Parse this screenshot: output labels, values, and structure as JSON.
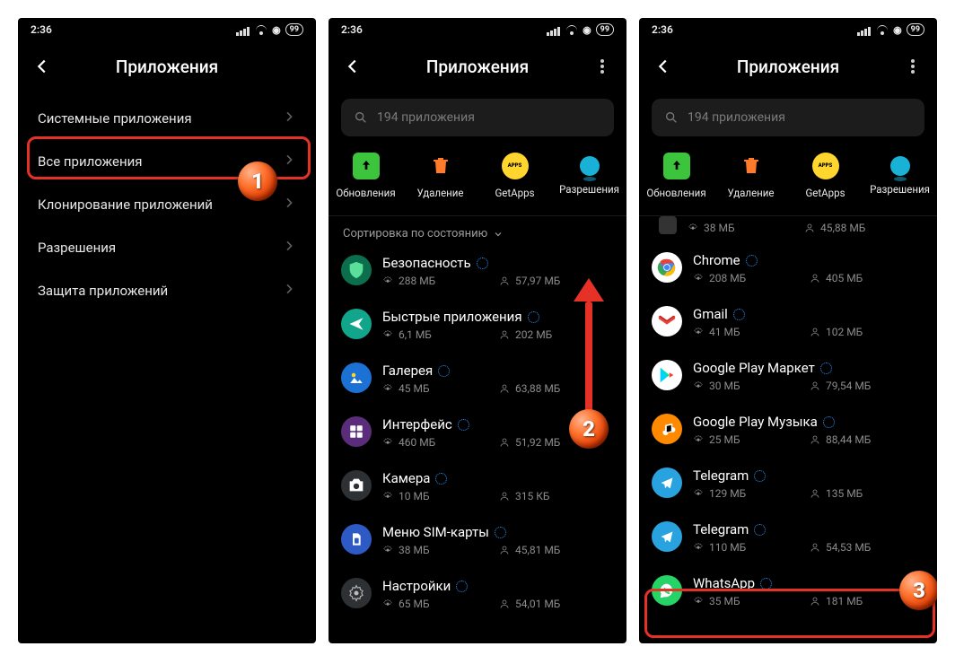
{
  "status": {
    "time": "2:36",
    "battery": "99"
  },
  "header": {
    "title": "Приложения",
    "search_placeholder": "194 приложения",
    "sort_label": "Сортировка по состоянию"
  },
  "screen1": {
    "rows": [
      {
        "label": "Системные приложения"
      },
      {
        "label": "Все приложения"
      },
      {
        "label": "Клонирование приложений"
      },
      {
        "label": "Разрешения"
      },
      {
        "label": "Защита приложений"
      }
    ]
  },
  "actions": [
    {
      "label": "Обновления"
    },
    {
      "label": "Удаление"
    },
    {
      "label": "GetApps"
    },
    {
      "label": "Разрешения"
    }
  ],
  "screen2_apps": [
    {
      "name": "Безопасность",
      "sizeA": "288 МБ",
      "sizeB": "57,97 МБ",
      "icon": "security"
    },
    {
      "name": "Быстрые приложения",
      "sizeA": "6,1 МБ",
      "sizeB": "202 МБ",
      "icon": "quick"
    },
    {
      "name": "Галерея",
      "sizeA": "45 МБ",
      "sizeB": "63,88 МБ",
      "icon": "gallery"
    },
    {
      "name": "Интерфейс",
      "sizeA": "460 МБ",
      "sizeB": "51,92 МБ",
      "icon": "interface"
    },
    {
      "name": "Камера",
      "sizeA": "10 МБ",
      "sizeB": "315 КБ",
      "icon": "camera"
    },
    {
      "name": "Меню SIM-карты",
      "sizeA": "38 МБ",
      "sizeB": "45,81 МБ",
      "icon": "sim"
    },
    {
      "name": "Настройки",
      "sizeA": "65 МБ",
      "sizeB": "54,01 МБ",
      "icon": "settings"
    }
  ],
  "screen3_partial": {
    "sizeA": "38 МБ",
    "sizeB": "45,88 МБ"
  },
  "screen3_apps": [
    {
      "name": "Chrome",
      "sizeA": "208 МБ",
      "sizeB": "405 МБ",
      "icon": "chrome"
    },
    {
      "name": "Gmail",
      "sizeA": "41 МБ",
      "sizeB": "102 МБ",
      "icon": "gmail"
    },
    {
      "name": "Google Play Маркет",
      "sizeA": "30 МБ",
      "sizeB": "79,54 МБ",
      "icon": "play"
    },
    {
      "name": "Google Play Музыка",
      "sizeA": "25 МБ",
      "sizeB": "88,44 МБ",
      "icon": "music"
    },
    {
      "name": "Telegram",
      "sizeA": "129 МБ",
      "sizeB": "135 МБ",
      "icon": "telegram"
    },
    {
      "name": "Telegram",
      "sizeA": "110 МБ",
      "sizeB": "54,53 МБ",
      "icon": "telegram"
    },
    {
      "name": "WhatsApp",
      "sizeA": "35 МБ",
      "sizeB": "181 МБ",
      "icon": "whatsapp"
    }
  ],
  "badges": {
    "b1": "1",
    "b2": "2",
    "b3": "3"
  },
  "getapps_text": "APPS"
}
